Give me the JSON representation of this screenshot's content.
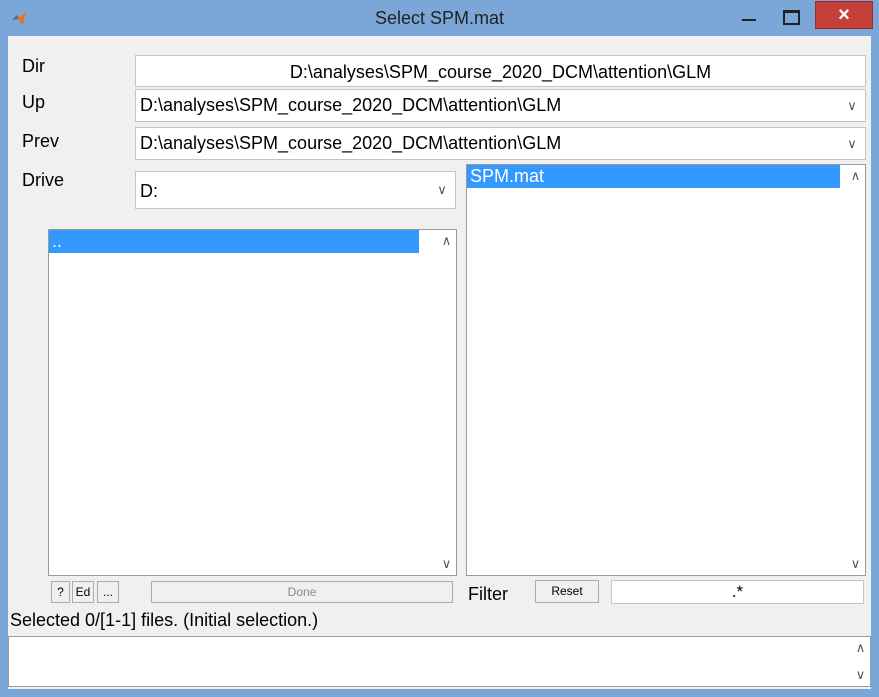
{
  "window": {
    "title": "Select SPM.mat",
    "close_glyph": "×"
  },
  "labels": {
    "dir": "Dir",
    "up": "Up",
    "prev": "Prev",
    "drive": "Drive",
    "filter": "Filter"
  },
  "dir_value": "D:\\analyses\\SPM_course_2020_DCM\\attention\\GLM",
  "up_value": "D:\\analyses\\SPM_course_2020_DCM\\attention\\GLM",
  "prev_value": "D:\\analyses\\SPM_course_2020_DCM\\attention\\GLM",
  "drive_value": "D:",
  "dirs_list": [
    ".."
  ],
  "files_list": [
    "SPM.mat"
  ],
  "buttons": {
    "help": "?",
    "edit": "Ed",
    "more": "...",
    "done": "Done",
    "reset": "Reset"
  },
  "filter_value": ".*",
  "status_text": "Selected 0/[1-1] files. (Initial selection.)",
  "glyphs": {
    "chevron_down": "∨",
    "chevron_up": "∧"
  },
  "colors": {
    "titlebar": "#7aa7d8",
    "selection": "#3399ff",
    "close": "#c6403a"
  }
}
